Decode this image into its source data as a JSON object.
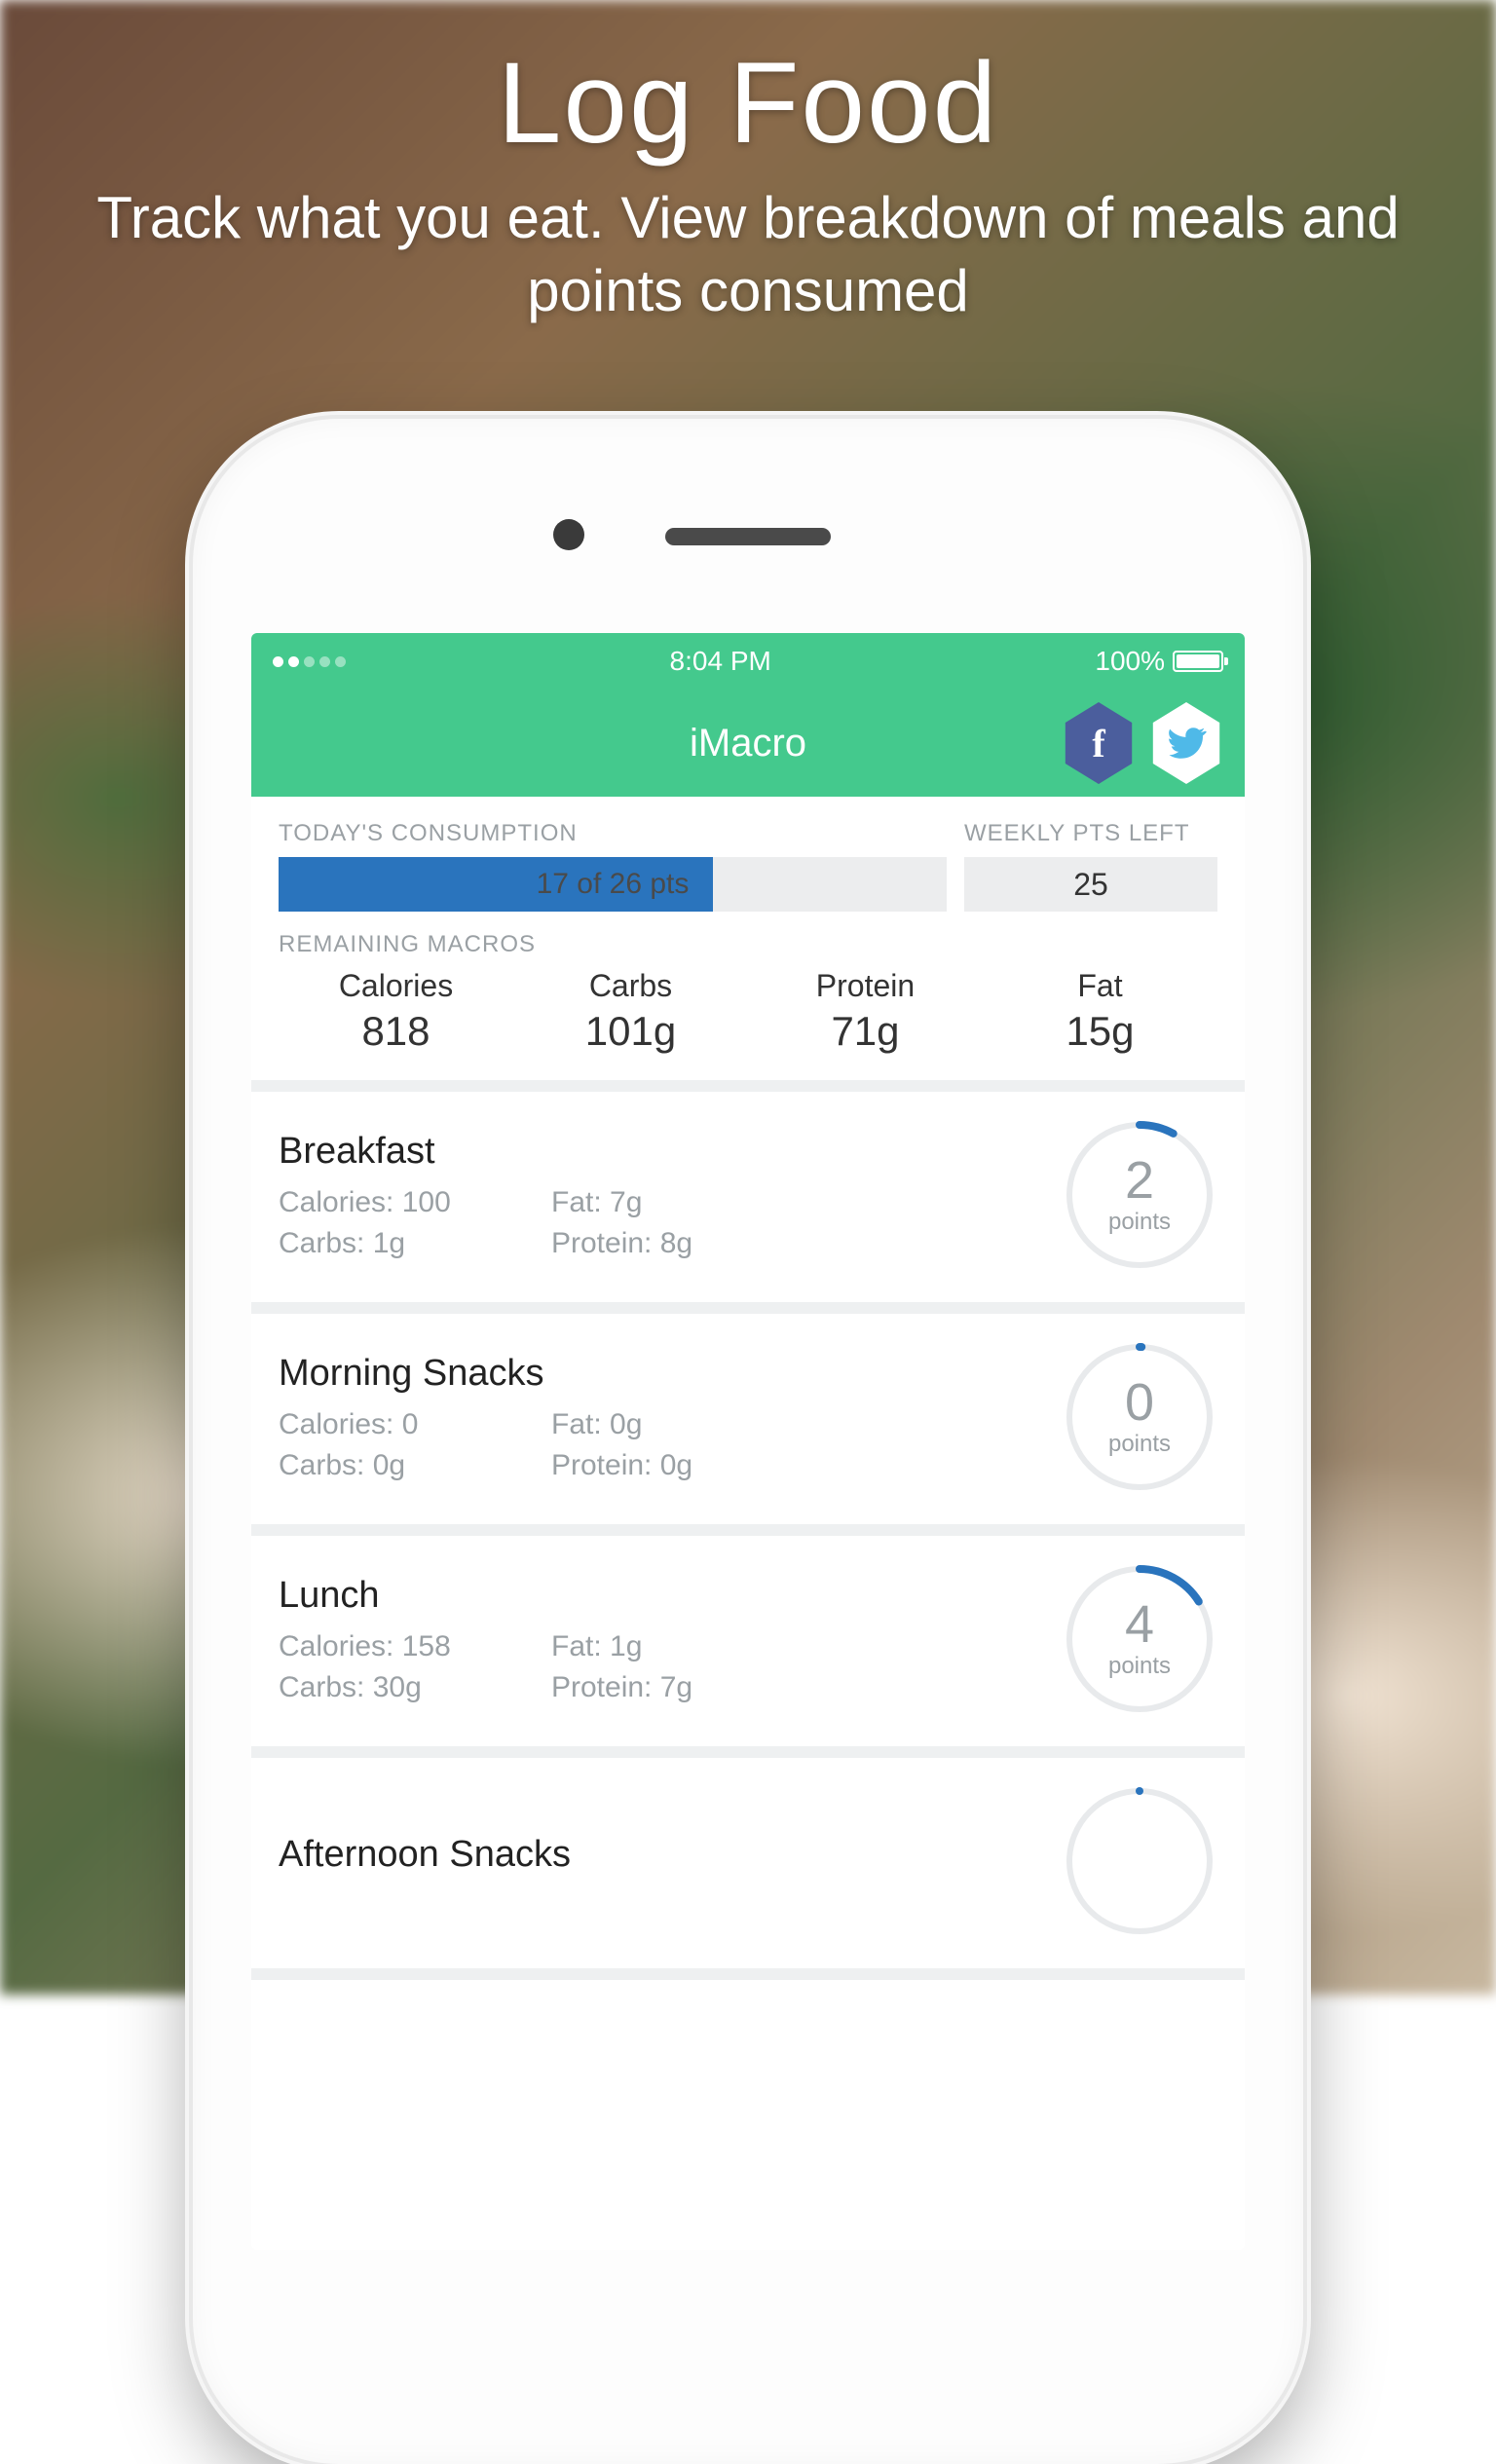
{
  "promo": {
    "title": "Log Food",
    "subtitle": "Track what you eat. View breakdown of meals and points consumed"
  },
  "status": {
    "time": "8:04 PM",
    "battery_pct": "100%"
  },
  "app": {
    "title": "iMacro"
  },
  "summary": {
    "consumption_label": "TODAY'S CONSUMPTION",
    "consumption_text": "17 of 26 pts",
    "consumption_fill_pct": 65,
    "weekly_label": "WEEKLY PTS LEFT",
    "weekly_value": "25",
    "remaining_label": "REMAINING MACROS",
    "macros": {
      "cal_label": "Calories",
      "cal_value": "818",
      "carb_label": "Carbs",
      "carb_value": "101g",
      "pro_label": "Protein",
      "pro_value": "71g",
      "fat_label": "Fat",
      "fat_value": "15g"
    }
  },
  "points_word": "points",
  "meals": [
    {
      "name": "Breakfast",
      "calories": "Calories: 100",
      "fat": "Fat: 7g",
      "carbs": "Carbs:   1g",
      "protein": "Protein: 8g",
      "points": "2",
      "ring_pct": 8
    },
    {
      "name": "Morning Snacks",
      "calories": "Calories: 0",
      "fat": "Fat: 0g",
      "carbs": "Carbs:   0g",
      "protein": "Protein: 0g",
      "points": "0",
      "ring_pct": 0.5
    },
    {
      "name": "Lunch",
      "calories": "Calories: 158",
      "fat": "Fat: 1g",
      "carbs": "Carbs:   30g",
      "protein": "Protein: 7g",
      "points": "4",
      "ring_pct": 16
    },
    {
      "name": "Afternoon Snacks",
      "calories": "",
      "fat": "",
      "carbs": "",
      "protein": "",
      "points": "",
      "ring_pct": 0
    }
  ]
}
